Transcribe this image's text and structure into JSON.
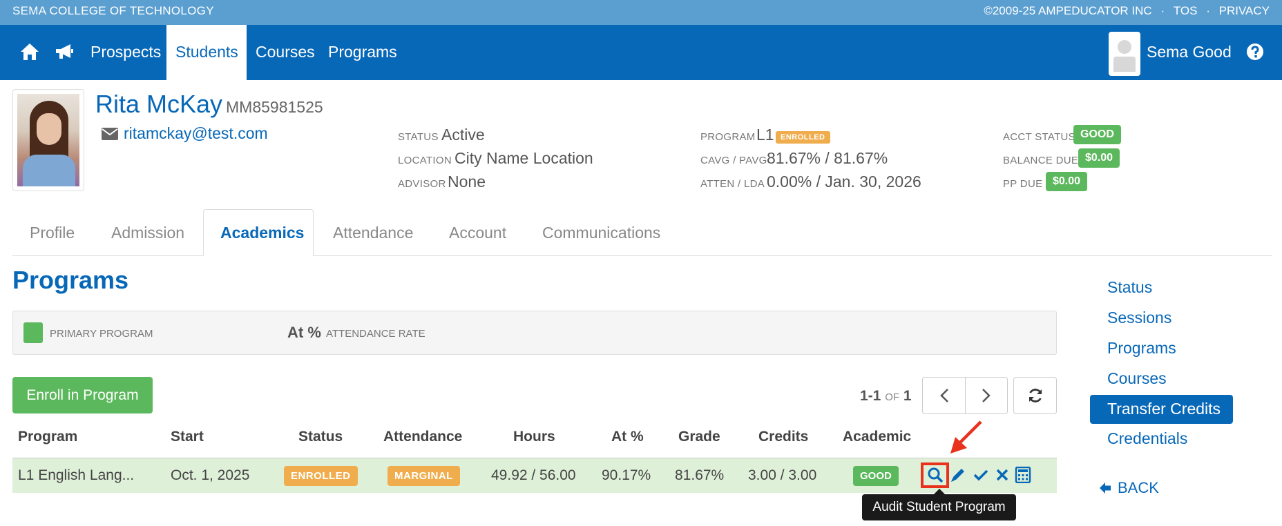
{
  "topbar": {
    "brand": "SEMA COLLEGE OF TECHNOLOGY",
    "copyright": "©2009-25 AMPEDUCATOR INC",
    "sep1": "·",
    "tos": "TOS",
    "sep2": "·",
    "privacy": "PRIVACY"
  },
  "nav": {
    "items": [
      "Prospects",
      "Students",
      "Courses",
      "Programs"
    ],
    "user_name": "Sema Good"
  },
  "student": {
    "name": "Rita McKay",
    "id": "MM85981525",
    "email": "ritamckay@test.com",
    "status_label": "STATUS",
    "status_value": "Active",
    "location_label": "LOCATION",
    "location_value": "City Name Location",
    "advisor_label": "ADVISOR",
    "advisor_value": "None",
    "program_label": "PROGRAM",
    "program_value": "L1",
    "program_badge": "ENROLLED",
    "cavg_label": "CAVG / PAVG",
    "cavg_value": "81.67% / 81.67%",
    "atten_label": "ATTEN / LDA",
    "atten_value": "0.00% / Jan. 30, 2026",
    "acct_label": "ACCT STATUS",
    "acct_value": "GOOD",
    "balance_label": "BALANCE DUE",
    "balance_value": "$0.00",
    "pp_label": "PP DUE",
    "pp_value": "$0.00"
  },
  "tabs": [
    "Profile",
    "Admission",
    "Academics",
    "Attendance",
    "Account",
    "Communications"
  ],
  "section": {
    "title": "Programs",
    "primary_label": "PRIMARY PROGRAM",
    "at_label": "At %",
    "attendance_rate_label": "ATTENDANCE RATE",
    "enroll_button": "Enroll in Program"
  },
  "pager": {
    "range": "1-1",
    "of": "OF",
    "total": "1"
  },
  "table": {
    "headers": [
      "Program",
      "Start",
      "Status",
      "Attendance",
      "Hours",
      "At %",
      "Grade",
      "Credits",
      "Academic"
    ],
    "rows": [
      {
        "program": "L1 English Lang...",
        "start": "Oct. 1, 2025",
        "status": "ENROLLED",
        "attendance": "MARGINAL",
        "hours": "49.92 / 56.00",
        "at_pct": "90.17%",
        "grade": "81.67%",
        "credits": "3.00 / 3.00",
        "academic": "GOOD"
      }
    ]
  },
  "tooltip": "Audit Student Program",
  "sidenav": {
    "items": [
      "Status",
      "Sessions",
      "Programs",
      "Courses",
      "Transfer Credits",
      "Credentials"
    ],
    "back": "BACK"
  },
  "colors": {
    "primary": "#0868b8",
    "topbar": "#5b9fd1",
    "success": "#5cb85c",
    "warning": "#f0ad4e",
    "row_bg": "#dff0d8",
    "highlight": "#e8321e"
  }
}
